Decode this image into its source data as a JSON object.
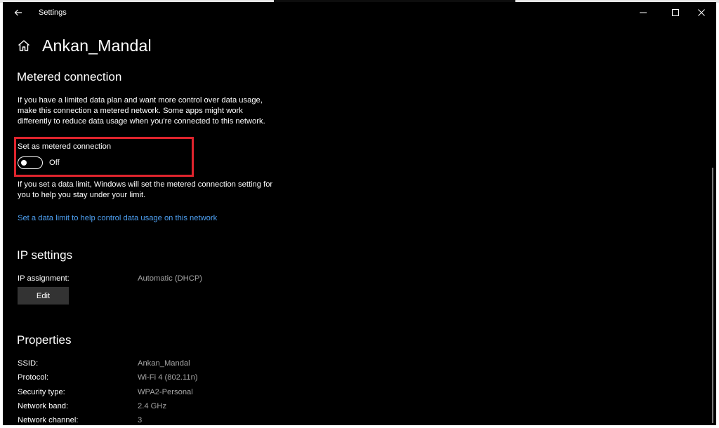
{
  "window": {
    "title": "Settings",
    "back_icon": "back-arrow-icon",
    "controls": [
      "minimize-icon",
      "maximize-icon",
      "close-icon"
    ]
  },
  "header": {
    "home_icon": "home-icon",
    "title": "Ankan_Mandal"
  },
  "metered": {
    "heading": "Metered connection",
    "description": "If you have a limited data plan and want more control over data usage, make this connection a metered network. Some apps might work differently to reduce data usage when you're connected to this network.",
    "toggle_label": "Set as metered connection",
    "toggle_state": "Off",
    "toggle_on": false,
    "highlight_color": "#e0242d",
    "limit_note": "If you set a data limit, Windows will set the metered connection setting for you to help you stay under your limit.",
    "limit_link": "Set a data limit to help control data usage on this network",
    "link_color": "#4ea1f3"
  },
  "ip": {
    "heading": "IP settings",
    "assignment_label": "IP assignment:",
    "assignment_value": "Automatic (DHCP)",
    "edit_label": "Edit"
  },
  "properties": {
    "heading": "Properties",
    "rows": [
      {
        "label": "SSID:",
        "value": "Ankan_Mandal"
      },
      {
        "label": "Protocol:",
        "value": "Wi-Fi 4 (802.11n)"
      },
      {
        "label": "Security type:",
        "value": "WPA2-Personal"
      },
      {
        "label": "Network band:",
        "value": "2.4 GHz"
      },
      {
        "label": "Network channel:",
        "value": "3"
      }
    ]
  }
}
